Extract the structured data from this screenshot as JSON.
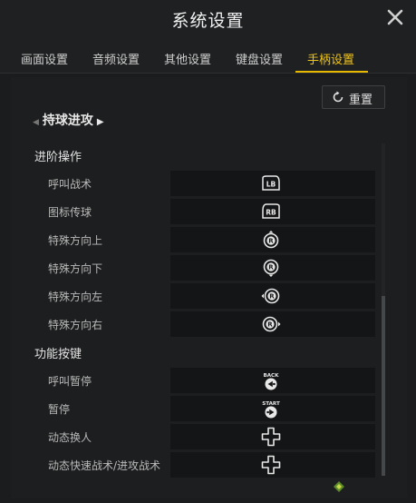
{
  "window": {
    "title": "系统设置"
  },
  "tabs": [
    "画面设置",
    "音频设置",
    "其他设置",
    "键盘设置",
    "手柄设置"
  ],
  "active_tab": "手柄设置",
  "reset": {
    "label": "重置"
  },
  "section": {
    "title": "持球进攻"
  },
  "groups": [
    {
      "title": "进阶操作",
      "rows": [
        {
          "label": "呼叫战术",
          "binding": "LB"
        },
        {
          "label": "图标传球",
          "binding": "RB"
        },
        {
          "label": "特殊方向上",
          "binding": "R-up"
        },
        {
          "label": "特殊方向下",
          "binding": "R-down"
        },
        {
          "label": "特殊方向左",
          "binding": "R-left"
        },
        {
          "label": "特殊方向右",
          "binding": "R-right"
        }
      ]
    },
    {
      "title": "功能按键",
      "rows": [
        {
          "label": "呼叫暂停",
          "binding": "BACK"
        },
        {
          "label": "暂停",
          "binding": "START"
        },
        {
          "label": "动态换人",
          "binding": "D-pad"
        },
        {
          "label": "动态快速战术/进攻战术",
          "binding": "D-pad"
        }
      ]
    }
  ],
  "glyph_text": {
    "lb": "LB",
    "rb": "RB",
    "r": "R",
    "back": "BACK",
    "start": "START"
  },
  "colors": {
    "accent": "#f0c419",
    "background": "#1b1c1d"
  }
}
